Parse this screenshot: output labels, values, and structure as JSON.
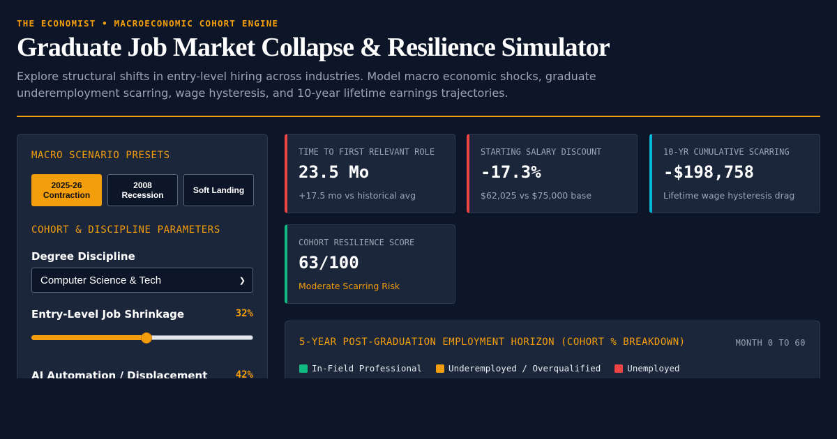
{
  "header": {
    "kicker": "THE ECONOMIST • MACROECONOMIC COHORT ENGINE",
    "title": "Graduate Job Market Collapse & Resilience Simulator",
    "subtitle": "Explore structural shifts in entry-level hiring across industries. Model macro economic shocks, graduate underemployment scarring, wage hysteresis, and 10-year lifetime earnings trajectories."
  },
  "colors": {
    "accent": "#f59e0b",
    "danger": "#ef4444",
    "info": "#06b6d4",
    "success": "#10b981"
  },
  "controls": {
    "presets_label": "MACRO SCENARIO PRESETS",
    "presets": [
      {
        "label": "2025-26 Contraction",
        "active": true
      },
      {
        "label": "2008 Recession",
        "active": false
      },
      {
        "label": "Soft Landing",
        "active": false
      }
    ],
    "params_label": "COHORT & DISCIPLINE PARAMETERS",
    "discipline": {
      "label": "Degree Discipline",
      "selected": "Computer Science & Tech"
    },
    "shrinkage": {
      "label": "Entry-Level Job Shrinkage",
      "value_text": "32%",
      "fraction": 0.52
    },
    "automation": {
      "label": "AI Automation / Displacement",
      "value_text": "42%"
    }
  },
  "metrics": [
    {
      "label": "TIME TO FIRST RELEVANT ROLE",
      "value": "23.5 Mo",
      "note": "+17.5 mo vs historical avg"
    },
    {
      "label": "STARTING SALARY DISCOUNT",
      "value": "-17.3%",
      "note": "$62,025 vs $75,000 base"
    },
    {
      "label": "10-YR CUMULATIVE SCARRING",
      "value": "-$198,758",
      "note": "Lifetime wage hysteresis drag"
    },
    {
      "label": "COHORT RESILIENCE SCORE",
      "value": "63/100",
      "note": "Moderate Scarring Risk"
    }
  ],
  "horizon": {
    "title": "5-YEAR POST-GRADUATION EMPLOYMENT HORIZON (COHORT % BREAKDOWN)",
    "range": "MONTH 0 TO 60",
    "legend": [
      {
        "label": "In-Field Professional",
        "color": "#10b981"
      },
      {
        "label": "Underemployed / Overqualified",
        "color": "#f59e0b"
      },
      {
        "label": "Unemployed",
        "color": "#ef4444"
      }
    ]
  }
}
